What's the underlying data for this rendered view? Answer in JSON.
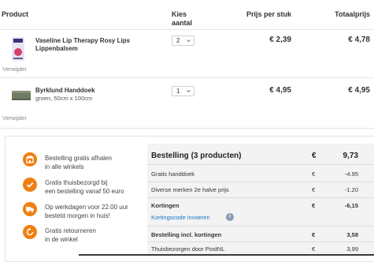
{
  "table": {
    "headers": {
      "product": "Product",
      "quantity_line1": "Kies",
      "quantity_line2": "aantal",
      "unit_price": "Prijs per stuk",
      "total_price": "Totaalprijs"
    },
    "rows": [
      {
        "name_line1": "Vaseline Lip Therapy Rosy Lips",
        "name_line2": "Lippenbalsem",
        "subtitle": "",
        "quantity": "2",
        "unit_price": "€ 2,39",
        "total_price": "€ 4,78",
        "remove_label": "Verwijder"
      },
      {
        "name_line1": "Byrklund Handdoek",
        "name_line2": "",
        "subtitle": "groen, 50cm x 100cm",
        "quantity": "1",
        "unit_price": "€ 4,95",
        "total_price": "€ 4,95",
        "remove_label": "Verwijder"
      }
    ]
  },
  "benefits": [
    {
      "icon": "store-icon",
      "line1": "Bestelling gratis afhalen",
      "line2": "in alle winkels"
    },
    {
      "icon": "check-circle-icon",
      "line1": "Gratis thuisbezorgd bij",
      "line2": "een bestelling vanaf 50 euro"
    },
    {
      "icon": "truck-icon",
      "line1": "Op werkdagen voor 22.00 uur",
      "line2": "besteld morgen in huis!"
    },
    {
      "icon": "return-icon",
      "line1": "Gratis retourneren",
      "line2": "in de winkel"
    }
  ],
  "summary": {
    "title": "Bestelling (3 producten)",
    "title_currency": "€",
    "title_value": "9,73",
    "lines": [
      {
        "label": "Gratis handdoek",
        "currency": "€",
        "value": "-4.95"
      },
      {
        "label": "Diverse merken 2e halve prijs",
        "currency": "€",
        "value": "-1.20"
      }
    ],
    "discounts_label": "Kortingen",
    "discounts_currency": "€",
    "discounts_value": "-6,15",
    "coupon_link": "Kortingscode invoeren",
    "incl_label": "Bestelling incl. kortingen",
    "incl_currency": "€",
    "incl_value": "3,58",
    "delivery_label": "Thuisbezorgen door PostNL",
    "delivery_currency": "€",
    "delivery_value": "3,99"
  },
  "colors": {
    "accent": "#f07f13",
    "link": "#1a73c7",
    "panel": "#f3f3f3"
  }
}
